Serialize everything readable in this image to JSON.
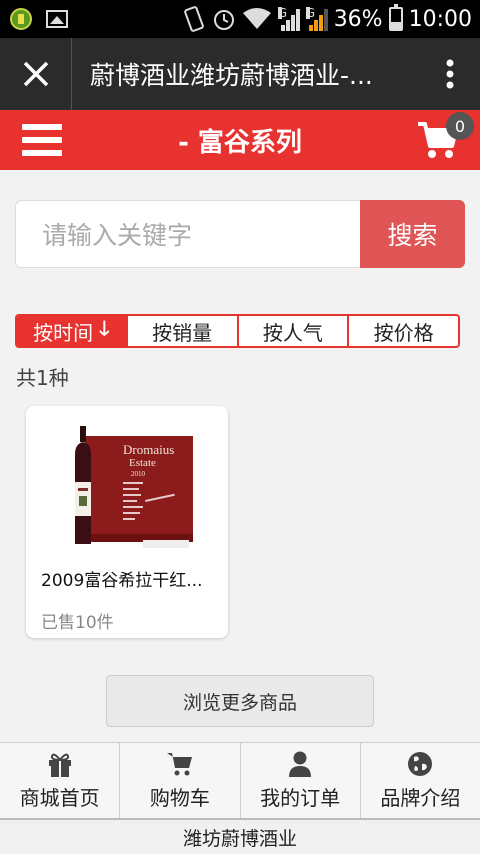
{
  "status_bar": {
    "battery": "36%",
    "time": "10:00",
    "network_1": "G",
    "network_2": "G"
  },
  "browser": {
    "title": "蔚博酒业潍坊蔚博酒业-..."
  },
  "header": {
    "title": "- 富谷系列",
    "cart_count": "0"
  },
  "search": {
    "placeholder": "请输入关键字",
    "button": "搜索"
  },
  "sort_tabs": [
    {
      "label": "按时间",
      "active": true
    },
    {
      "label": "按销量",
      "active": false
    },
    {
      "label": "按人气",
      "active": false
    },
    {
      "label": "按价格",
      "active": false
    }
  ],
  "result_count": "共1种",
  "products": [
    {
      "name": "2009富谷希拉干红...",
      "sold": "已售10件",
      "image_text": {
        "brand_line1": "Dromaius",
        "brand_line2": "Estate",
        "year": "2010"
      }
    }
  ],
  "more_button": "浏览更多商品",
  "bottom_nav": [
    {
      "label": "商城首页",
      "icon": "gift-icon"
    },
    {
      "label": "购物车",
      "icon": "cart-icon"
    },
    {
      "label": "我的订单",
      "icon": "user-icon"
    },
    {
      "label": "品牌介绍",
      "icon": "globe-icon"
    }
  ],
  "footer": "潍坊蔚博酒业",
  "colors": {
    "accent": "#e8322f",
    "search_button": "#e05556",
    "title_bar": "#2b2b2b"
  }
}
